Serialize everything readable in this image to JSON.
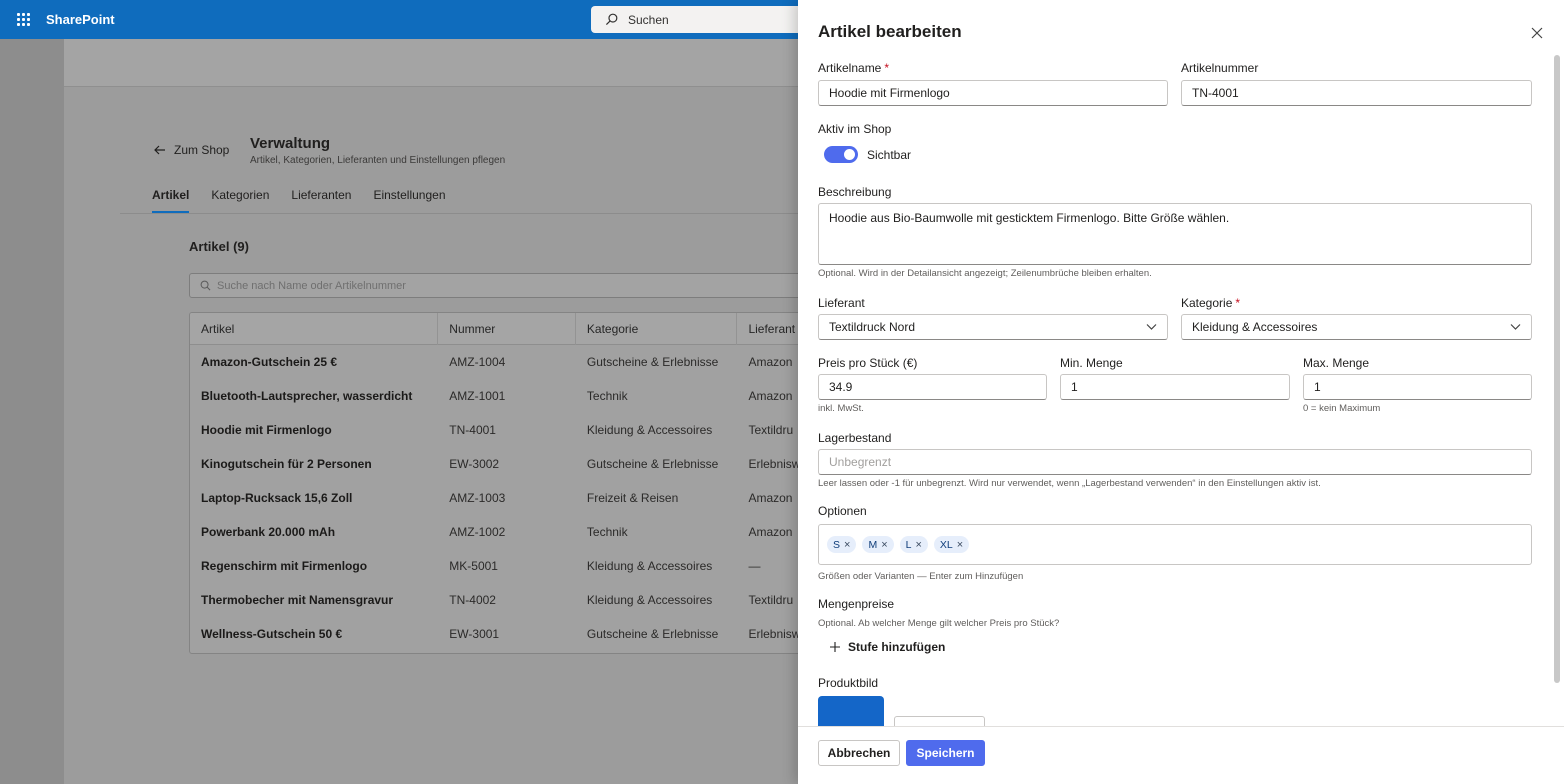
{
  "topbar": {
    "brand": "SharePoint",
    "search_placeholder": "Suchen"
  },
  "page": {
    "back_label": "Zum Shop",
    "title": "Verwaltung",
    "subtitle": "Artikel, Kategorien, Lieferanten und Einstellungen pflegen",
    "tabs": [
      {
        "label": "Artikel",
        "active": true
      },
      {
        "label": "Kategorien"
      },
      {
        "label": "Lieferanten"
      },
      {
        "label": "Einstellungen"
      }
    ],
    "list_title": "Artikel (9)",
    "search_placeholder": "Suche nach Name oder Artikelnummer",
    "columns": [
      "Artikel",
      "Nummer",
      "Kategorie",
      "Lieferant"
    ],
    "rows": [
      {
        "name": "Amazon-Gutschein 25 €",
        "number": "AMZ-1004",
        "category": "Gutscheine & Erlebnisse",
        "supplier": "Amazon"
      },
      {
        "name": "Bluetooth-Lautsprecher, wasserdicht",
        "number": "AMZ-1001",
        "category": "Technik",
        "supplier": "Amazon"
      },
      {
        "name": "Hoodie mit Firmenlogo",
        "number": "TN-4001",
        "category": "Kleidung & Accessoires",
        "supplier": "Textildru"
      },
      {
        "name": "Kinogutschein für 2 Personen",
        "number": "EW-3002",
        "category": "Gutscheine & Erlebnisse",
        "supplier": "Erlebnisw"
      },
      {
        "name": "Laptop-Rucksack 15,6 Zoll",
        "number": "AMZ-1003",
        "category": "Freizeit & Reisen",
        "supplier": "Amazon"
      },
      {
        "name": "Powerbank 20.000 mAh",
        "number": "AMZ-1002",
        "category": "Technik",
        "supplier": "Amazon"
      },
      {
        "name": "Regenschirm mit Firmenlogo",
        "number": "MK-5001",
        "category": "Kleidung & Accessoires",
        "supplier": "—"
      },
      {
        "name": "Thermobecher mit Namensgravur",
        "number": "TN-4002",
        "category": "Kleidung & Accessoires",
        "supplier": "Textildru"
      },
      {
        "name": "Wellness-Gutschein 50 €",
        "number": "EW-3001",
        "category": "Gutscheine & Erlebnisse",
        "supplier": "Erlebnisw"
      }
    ]
  },
  "panel": {
    "title": "Artikel bearbeiten",
    "name_label": "Artikelname",
    "name_value": "Hoodie mit Firmenlogo",
    "number_label": "Artikelnummer",
    "number_value": "TN-4001",
    "active_label": "Aktiv im Shop",
    "active_state": "Sichtbar",
    "active_on": true,
    "description_label": "Beschreibung",
    "description_value": "Hoodie aus Bio-Baumwolle mit gesticktem Firmenlogo. Bitte Größe wählen.",
    "description_hint": "Optional. Wird in der Detailansicht angezeigt; Zeilenumbrüche bleiben erhalten.",
    "supplier_label": "Lieferant",
    "supplier_value": "Textildruck Nord",
    "category_label": "Kategorie",
    "category_value": "Kleidung & Accessoires",
    "price_label": "Preis pro Stück (€)",
    "price_value": "34.9",
    "price_hint": "inkl. MwSt.",
    "min_label": "Min. Menge",
    "min_value": "1",
    "max_label": "Max. Menge",
    "max_value": "1",
    "max_hint": "0 = kein Maximum",
    "stock_label": "Lagerbestand",
    "stock_placeholder": "Unbegrenzt",
    "stock_hint": "Leer lassen oder -1 für unbegrenzt. Wird nur verwendet, wenn „Lagerbestand verwenden“ in den Einstellungen aktiv ist.",
    "options_label": "Optionen",
    "options": [
      "S",
      "M",
      "L",
      "XL"
    ],
    "options_hint": "Größen oder Varianten — Enter zum Hinzufügen",
    "tiers_label": "Mengenpreise",
    "tiers_hint": "Optional. Ab welcher Menge gilt welcher Preis pro Stück?",
    "add_tier_label": "Stufe hinzufügen",
    "image_label": "Produktbild",
    "image_color": "#1466c8",
    "cancel_label": "Abbrechen",
    "save_label": "Speichern"
  },
  "colors": {
    "brand_bar": "#0f6cbd",
    "accent": "#4f6bed",
    "required": "#c50f1f"
  }
}
